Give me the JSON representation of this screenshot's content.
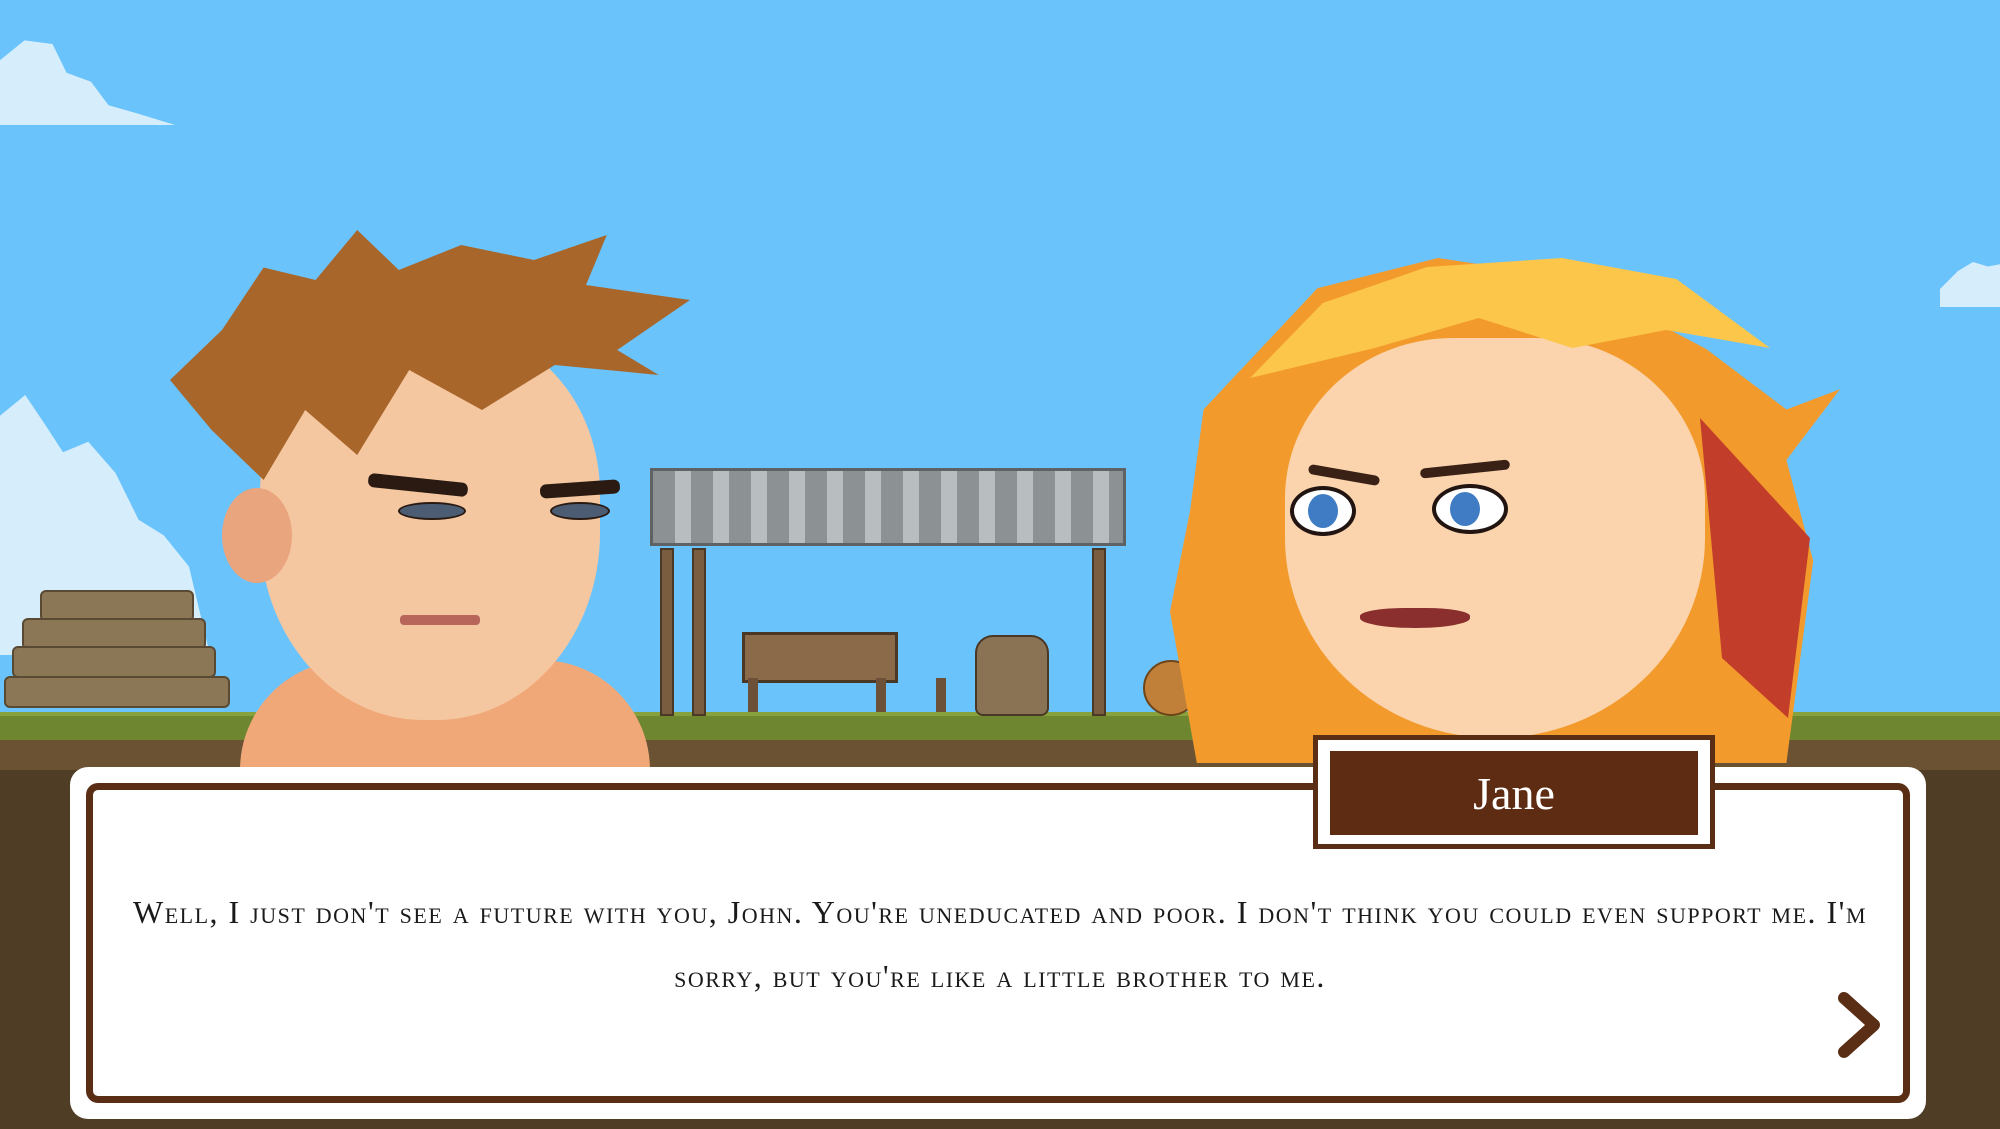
{
  "dialogue": {
    "speaker": "Jane",
    "text": "Well, I just don't see a future with you, John. You're uneducated and poor. I don't think you could even support me. I'm sorry, but you're like a little brother to me."
  },
  "controls": {
    "next_icon": "chevron-right-icon"
  },
  "colors": {
    "sky": "#6bc3fc",
    "dialog_border": "#5a2d15",
    "name_plate": "#5e2c13",
    "dialog_text": "#1a1a1a"
  }
}
